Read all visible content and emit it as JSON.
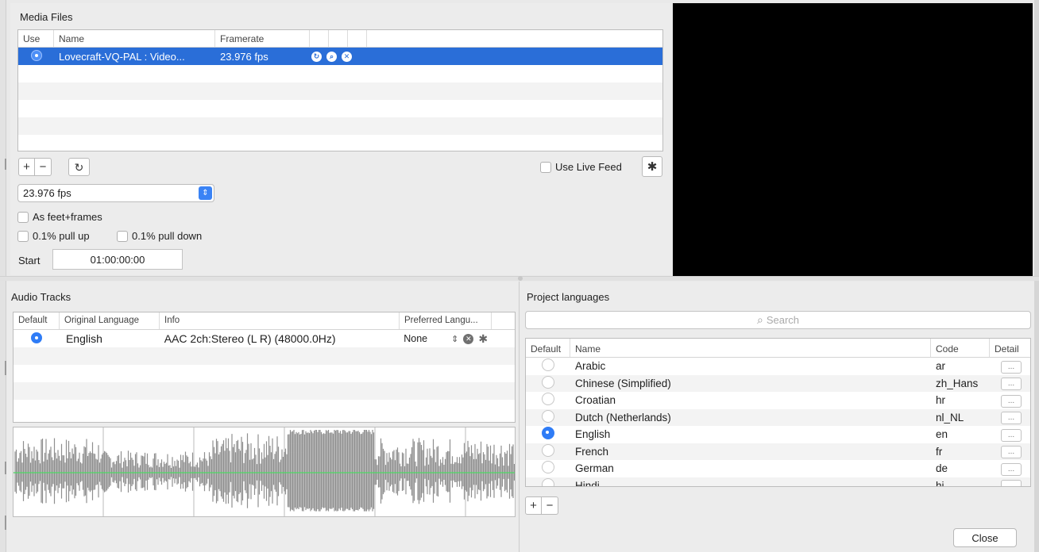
{
  "media": {
    "title": "Media Files",
    "columns": {
      "use": "Use",
      "name": "Name",
      "framerate": "Framerate"
    },
    "row": {
      "name": "Lovecraft-VQ-PAL : Video...",
      "framerate": "23.976 fps"
    },
    "framerate_select": "23.976 fps",
    "as_feet_frames": "As feet+frames",
    "pull_up": "0.1% pull up",
    "pull_down": "0.1% pull down",
    "start_label": "Start",
    "start_value": "01:00:00:00",
    "live_feed": "Use Live Feed",
    "add_symbol": "+",
    "remove_symbol": "−"
  },
  "audio": {
    "title": "Audio Tracks",
    "columns": {
      "default": "Default",
      "language": "Original Language",
      "info": "Info",
      "preferred": "Preferred Langu..."
    },
    "row": {
      "language": "English",
      "info": "AAC  2ch:Stereo (L R) (48000.0Hz)",
      "preferred": "None"
    }
  },
  "languages": {
    "title": "Project languages",
    "search_placeholder": "Search",
    "columns": {
      "default": "Default",
      "name": "Name",
      "code": "Code",
      "detail": "Detail"
    },
    "rows": [
      {
        "name": "Arabic",
        "code": "ar",
        "default": false
      },
      {
        "name": "Chinese (Simplified)",
        "code": "zh_Hans",
        "default": false
      },
      {
        "name": "Croatian",
        "code": "hr",
        "default": false
      },
      {
        "name": "Dutch (Netherlands)",
        "code": "nl_NL",
        "default": false
      },
      {
        "name": "English",
        "code": "en",
        "default": true
      },
      {
        "name": "French",
        "code": "fr",
        "default": false
      },
      {
        "name": "German",
        "code": "de",
        "default": false
      },
      {
        "name": "Hindi",
        "code": "hi",
        "default": false
      }
    ],
    "detail_label": "...",
    "add_symbol": "+",
    "remove_symbol": "−"
  },
  "close_label": "Close",
  "colors": {
    "selection": "#2a6ed8",
    "accent": "#2f7cf6",
    "waveform": "#8f8f8f",
    "waveform_center": "#4cd964"
  },
  "icons": {
    "refresh": "refresh-icon",
    "gear": "gear-icon",
    "reveal": "reveal-icon",
    "search": "search-icon",
    "remove": "remove-icon",
    "stepper": "stepper-icon"
  }
}
